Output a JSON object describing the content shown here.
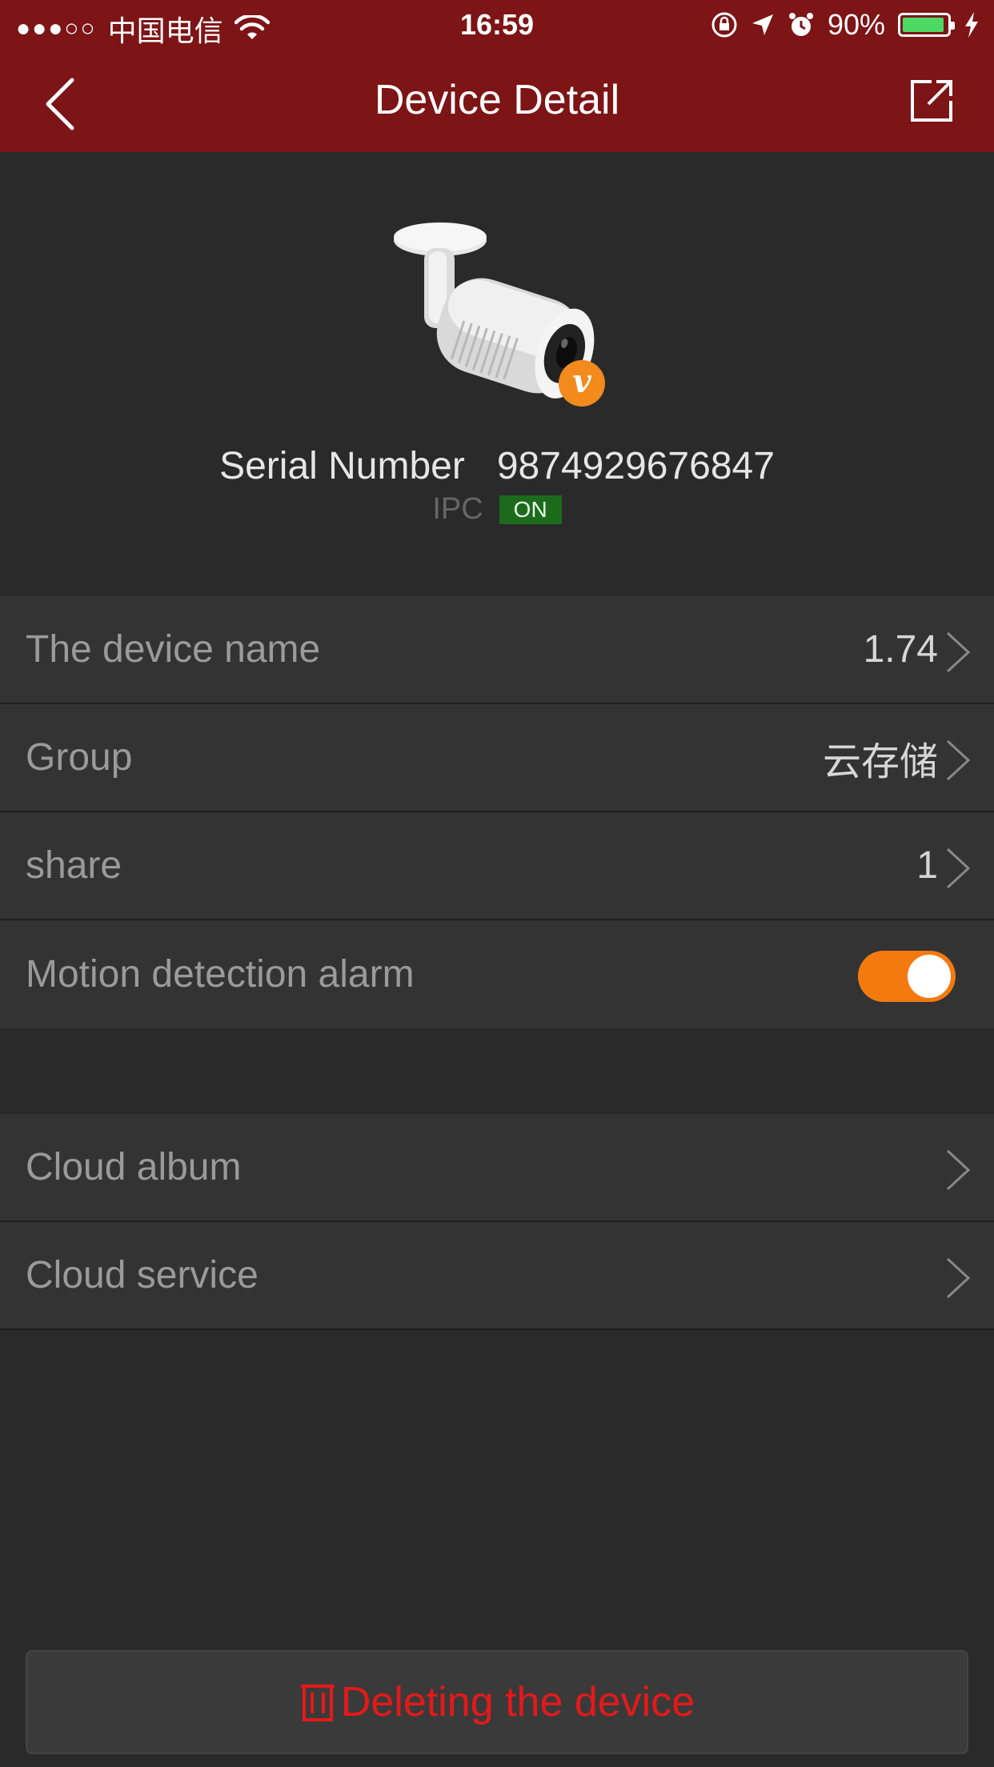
{
  "status_bar": {
    "signal": "●●●○○",
    "carrier": "中国电信",
    "time": "16:59",
    "battery": "90%",
    "battery_color": "#4cd964"
  },
  "header": {
    "title": "Device Detail",
    "back_icon": "chevron-left-icon",
    "share_icon": "external-link-icon",
    "background": "#7d1416"
  },
  "device": {
    "serial_label": "Serial Number",
    "serial_number": "9874929676847",
    "type": "IPC",
    "status": "ON",
    "badge": "v"
  },
  "settings": [
    {
      "label": "The device name",
      "value": "1.74"
    },
    {
      "label": "Group",
      "value": "云存储"
    },
    {
      "label": "share",
      "value": "1"
    }
  ],
  "motion_alarm": {
    "label": "Motion detection alarm",
    "enabled": true,
    "accent": "#f47a0f"
  },
  "cloud": [
    {
      "label": "Cloud album"
    },
    {
      "label": "Cloud service"
    }
  ],
  "delete": {
    "label": "Deleting the device",
    "icon": "trash-icon",
    "color": "#e51919"
  }
}
